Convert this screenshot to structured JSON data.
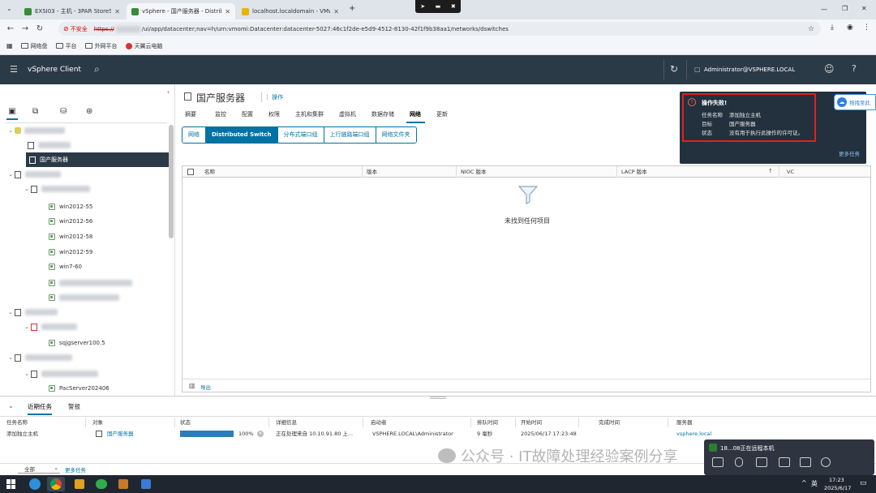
{
  "browser": {
    "tabs": [
      {
        "label": "EXSI03 - 主机 - 3PAR StoreSer"
      },
      {
        "label": "vSphere - 国产服务器 - Distrib"
      },
      {
        "label": "localhost.localdomain - VMw"
      }
    ],
    "new_tab_glyph": "+",
    "security_label": "不安全",
    "url_scheme": "https://",
    "url_rest": "/ui/app/datacenter;nav=h/urn:vmomi:Datacenter:datacenter-5027:46c1f2de-e5d9-4512-8130-42f1f9b38aa1/networks/dswitches",
    "bookmarks": [
      {
        "label": "网络盘"
      },
      {
        "label": "平台"
      },
      {
        "label": "外网平台"
      },
      {
        "label": "天翼云电脑"
      }
    ]
  },
  "vsphere": {
    "app_title": "vSphere Client",
    "user": "Administrator@VSPHERE.LOCAL"
  },
  "nav": {
    "tree": [
      {
        "label": "国产服务器"
      },
      {
        "label": "win2012-55"
      },
      {
        "label": "win2012-56"
      },
      {
        "label": "win2012-58"
      },
      {
        "label": "win2012-59"
      },
      {
        "label": "win7-60"
      },
      {
        "label": "sqjgserver100.5"
      },
      {
        "label": "PacServer202406"
      }
    ]
  },
  "object": {
    "title": "国产服务器",
    "actions_label": "操作",
    "tabs": [
      {
        "label": "摘要"
      },
      {
        "label": "监控"
      },
      {
        "label": "配置"
      },
      {
        "label": "权限"
      },
      {
        "label": "主机和集群"
      },
      {
        "label": "虚拟机"
      },
      {
        "label": "数据存储"
      },
      {
        "label": "网络"
      },
      {
        "label": "更新"
      }
    ],
    "network_subtabs": [
      {
        "label": "网络"
      },
      {
        "label": "Distributed Switch"
      },
      {
        "label": "分布式端口组"
      },
      {
        "label": "上行链路端口组"
      },
      {
        "label": "网络文件夹"
      }
    ],
    "grid": {
      "columns": [
        {
          "label": "名称"
        },
        {
          "label": "版本"
        },
        {
          "label": "NIOC 版本"
        },
        {
          "label": "LACP 版本"
        },
        {
          "label": "VC"
        }
      ],
      "empty_text": "未找到任何项目",
      "export_label": "导出"
    }
  },
  "tasks": {
    "tabs": [
      {
        "label": "近期任务"
      },
      {
        "label": "警报"
      }
    ],
    "columns": [
      {
        "label": "任务名称"
      },
      {
        "label": "对象"
      },
      {
        "label": "状态"
      },
      {
        "label": "详细信息"
      },
      {
        "label": "启动者"
      },
      {
        "label": "排队时间"
      },
      {
        "label": "开始时间"
      },
      {
        "label": "完成时间"
      },
      {
        "label": "服务器"
      }
    ],
    "rows": [
      {
        "task": "添加独立主机",
        "object": "国产服务器",
        "progress": 100,
        "progress_text": "100%",
        "details": "正在处理来自 10.10.91.80 上...",
        "initiator": "VSPHERE.LOCAL\\Administrator",
        "queued": "9 毫秒",
        "start": "2025/06/17 17:23:48",
        "end": "",
        "server": "vsphere.local"
      }
    ],
    "filter_value": "全部",
    "more_tasks_label": "更多任务"
  },
  "error_popup": {
    "title": "操作失败!",
    "task_label": "任务名称",
    "task_value": "添加独立主机",
    "target_label": "目标",
    "target_value": "国产服务器",
    "status_label": "状态",
    "status_value": "没有用于执行此操作的许可证。",
    "more_label": "更多任务"
  },
  "side_widget": {
    "label": "拖拽至此"
  },
  "watermark": "公众号 · IT故障处理经验案例分享",
  "float_toolbar": {
    "label": "18...08正在远程本机"
  },
  "taskbar": {
    "ime": "英",
    "time": "17:23",
    "date": "2025/6/17"
  },
  "colors": {
    "header_bg": "#2b3a47",
    "accent": "#0072a3",
    "error_red": "#e02020",
    "popup_bg": "#22313d"
  }
}
